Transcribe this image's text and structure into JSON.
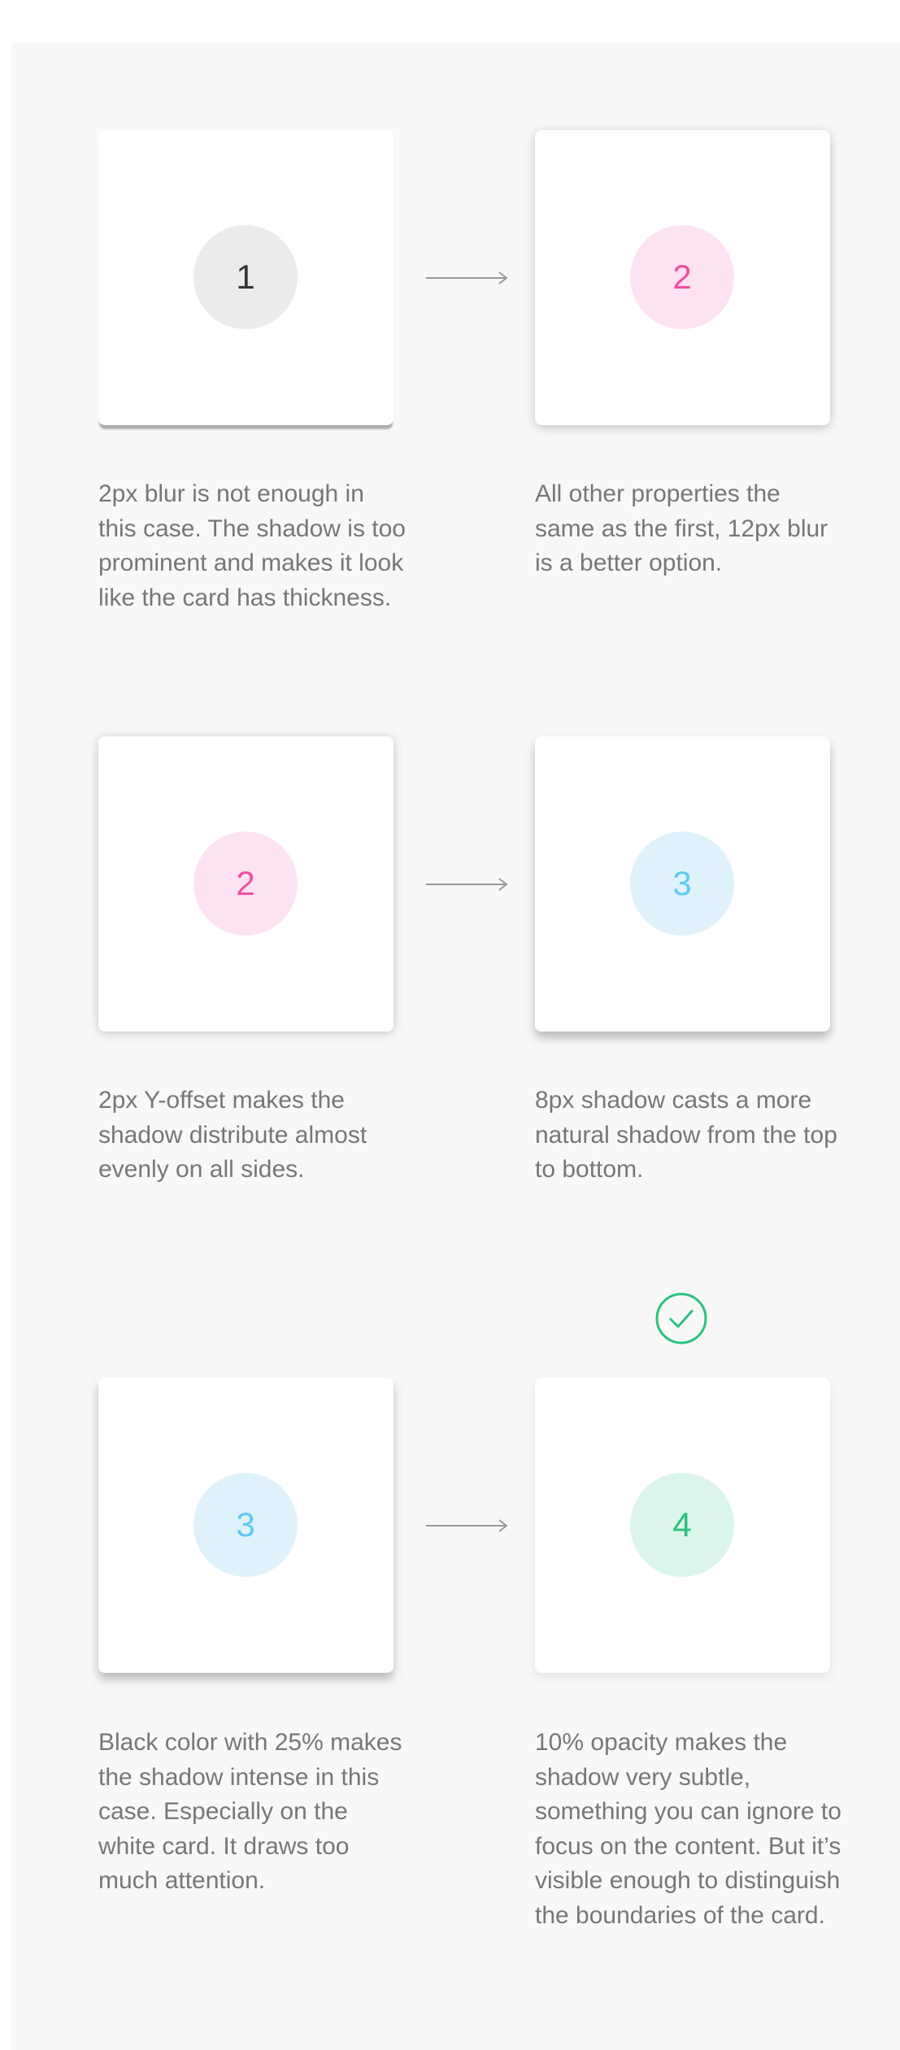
{
  "rows": [
    {
      "left_number": "1",
      "right_number": "2",
      "left_caption": "2px blur is not enough in this case. The shadow is too prominent and makes it look like the card has thickness.",
      "right_caption": "All other properties the same as the first, 12px blur is a better option."
    },
    {
      "left_number": "2",
      "right_number": "3",
      "left_caption": "2px Y-offset makes the shadow distribute almost evenly on all sides.",
      "right_caption": "8px shadow casts a more natural shadow from the top to bottom."
    },
    {
      "left_number": "3",
      "right_number": "4",
      "left_caption": "Black color with 25% makes the shadow intense in this case. Especially on the white card. It draws too much attention.",
      "right_caption": "10% opacity makes the shadow very subtle, something you can ignore to focus on the content. But it’s visible enough to distinguish the boundaries of the card."
    }
  ],
  "colors": {
    "panel_background": "#f8f8f8",
    "card_background": "#ffffff",
    "caption_text": "#777777",
    "arrow": "#999999",
    "check": "#2bc17f",
    "number_gray": "#333333",
    "number_pink": "#f0509e",
    "number_blue": "#5fcbf2",
    "number_green": "#2bc17f"
  },
  "icons": {
    "arrow": "arrow-right-icon",
    "approved": "check-circle-icon"
  }
}
